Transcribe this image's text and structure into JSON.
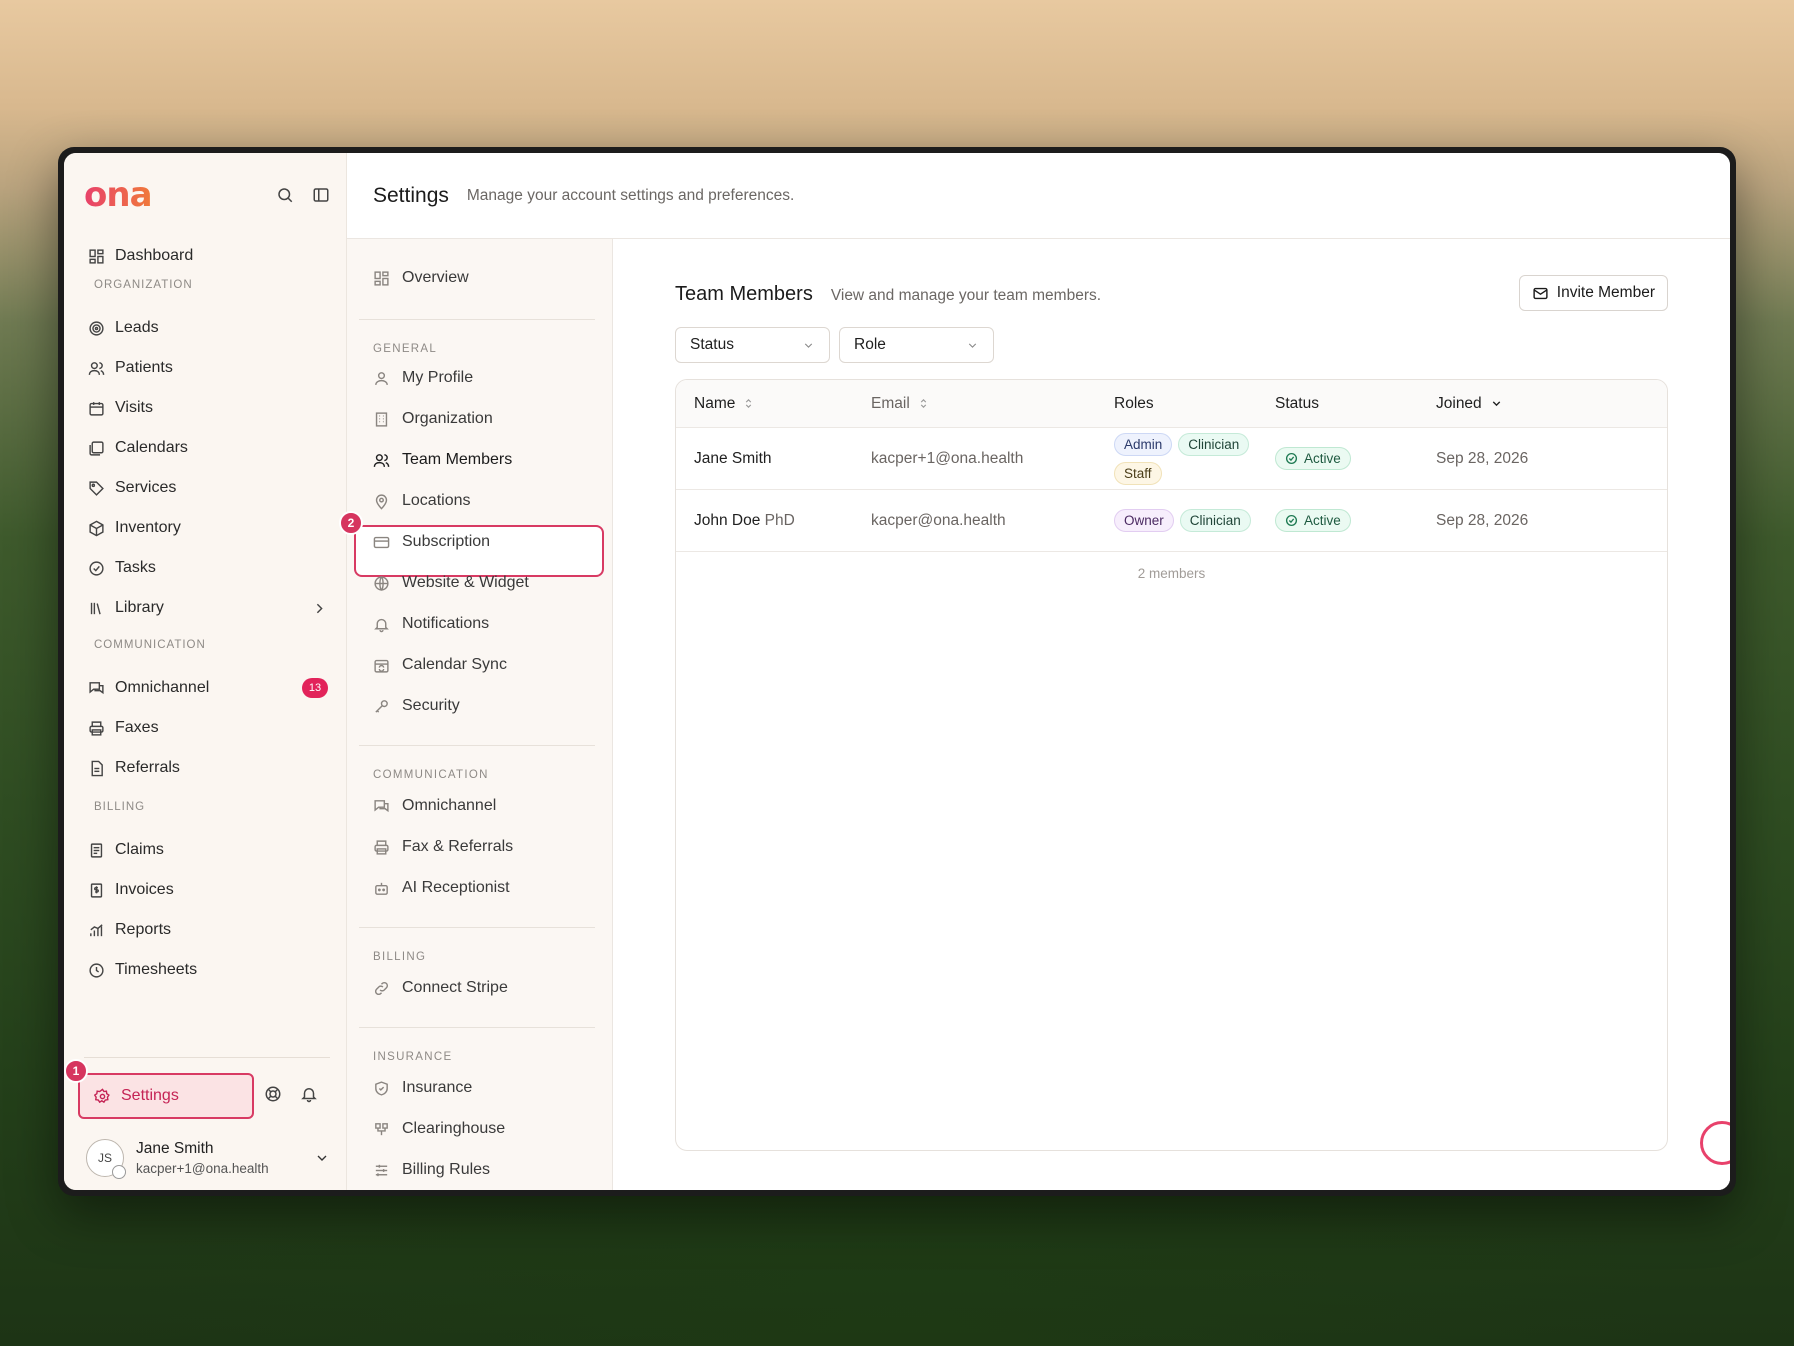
{
  "brand": {
    "logo": "ona"
  },
  "sidebar": {
    "dashboard": "Dashboard",
    "sections": {
      "organization": "ORGANIZATION",
      "communication": "COMMUNICATION",
      "billing": "BILLING"
    },
    "org_items": [
      "Leads",
      "Patients",
      "Visits",
      "Calendars",
      "Services",
      "Inventory",
      "Tasks",
      "Library"
    ],
    "comm_items": [
      "Omnichannel",
      "Faxes",
      "Referrals"
    ],
    "omnichannel_badge": "13",
    "billing_items": [
      "Claims",
      "Invoices",
      "Reports",
      "Timesheets"
    ],
    "settings_label": "Settings",
    "step1": "1",
    "step2": "2",
    "user": {
      "initials": "JS",
      "name": "Jane Smith",
      "email": "kacper+1@ona.health"
    }
  },
  "header": {
    "title": "Settings",
    "subtitle": "Manage your account settings and preferences."
  },
  "settings_nav": {
    "overview": "Overview",
    "general_label": "GENERAL",
    "general": [
      "My Profile",
      "Organization",
      "Team Members",
      "Locations",
      "Subscription",
      "Website & Widget",
      "Notifications",
      "Calendar Sync",
      "Security"
    ],
    "communication_label": "COMMUNICATION",
    "communication": [
      "Omnichannel",
      "Fax & Referrals",
      "AI Receptionist"
    ],
    "billing_label": "BILLING",
    "billing": [
      "Connect Stripe"
    ],
    "insurance_label": "INSURANCE",
    "insurance": [
      "Insurance",
      "Clearinghouse",
      "Billing Rules"
    ]
  },
  "team": {
    "title": "Team Members",
    "subtitle": "View and manage your team members.",
    "invite_label": "Invite Member",
    "filters": {
      "status": "Status",
      "role": "Role"
    },
    "columns": {
      "name": "Name",
      "email": "Email",
      "roles": "Roles",
      "status": "Status",
      "joined": "Joined"
    },
    "rows": [
      {
        "name": "Jane Smith",
        "suffix": "",
        "email": "kacper+1@ona.health",
        "roles": [
          "Admin",
          "Clinician",
          "Staff"
        ],
        "status": "Active",
        "joined": "Sep 28, 2026"
      },
      {
        "name": "John Doe",
        "suffix": "PhD",
        "email": "kacper@ona.health",
        "roles": [
          "Owner",
          "Clinician"
        ],
        "status": "Active",
        "joined": "Sep 28, 2026"
      }
    ],
    "count": "2 members"
  },
  "colors": {
    "accent": "#d83a63",
    "badge": "#e2235a"
  }
}
